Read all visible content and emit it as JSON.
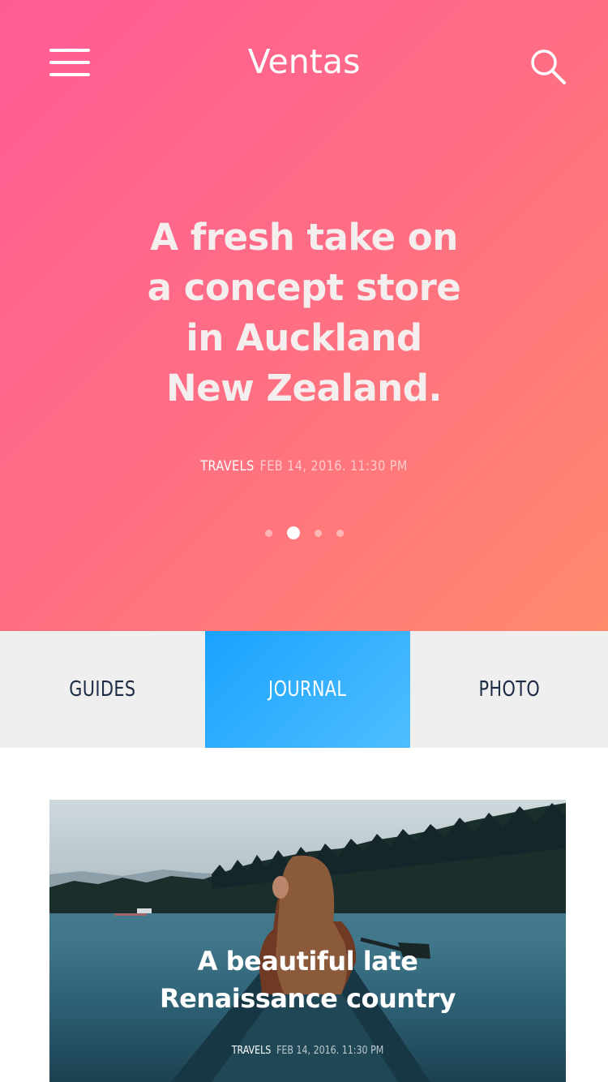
{
  "header": {
    "title": "Ventas",
    "menu_icon": "hamburger-menu-icon",
    "search_icon": "search-icon"
  },
  "hero": {
    "headline_lines": [
      "A fresh take on",
      "a concept store",
      "in Auckland",
      "New Zealand."
    ],
    "category": "TRAVELS",
    "date": "FEB 14, 2016. 11:30 PM",
    "slides_total": 4,
    "active_slide": 2,
    "gradient_colors": [
      "#ff5c95",
      "#ff8a6c"
    ]
  },
  "tabs": [
    {
      "label": "GUIDES",
      "active": false
    },
    {
      "label": "JOURNAL",
      "active": true
    },
    {
      "label": "PHOTO",
      "active": false
    }
  ],
  "tab_active_color": "#1aa2ff",
  "card": {
    "title_lines": [
      "A beautiful late",
      "Renaissance country"
    ],
    "category": "TRAVELS",
    "date": "FEB 14, 2016. 11:30 PM"
  }
}
